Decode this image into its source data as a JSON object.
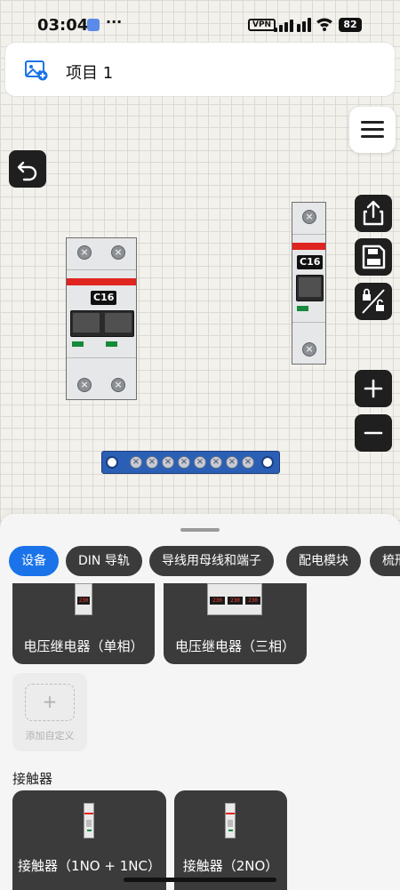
{
  "status_bar": {
    "time": "03:04",
    "dots": "···",
    "vpn": "VPN",
    "battery": "82"
  },
  "project": {
    "title": "项目 1"
  },
  "canvas": {
    "breaker_double": {
      "label": "C16",
      "screw": "×"
    },
    "breaker_single": {
      "label": "C16",
      "screw": "×"
    }
  },
  "toolbar": {
    "icons": [
      "share-icon",
      "save-icon",
      "lock-unlock-icon",
      "zoom-in-icon",
      "zoom-out-icon",
      "undo-icon",
      "menu-icon"
    ]
  },
  "sheet": {
    "tabs": [
      "设备",
      "DIN 导轨",
      "导线用母线和端子",
      "配电模块",
      "梳形"
    ],
    "active_tab": "设备",
    "cards_row1": [
      {
        "label": "电压继电器（单相）",
        "digits": [
          "230"
        ]
      },
      {
        "label": "电压继电器（三相）",
        "digits": [
          "230",
          "230",
          "230"
        ]
      }
    ],
    "add_custom": {
      "plus": "+",
      "label": "添加自定义"
    },
    "section_title": "接触器",
    "cards_row2": [
      {
        "label": "接触器（1NO + 1NC）"
      },
      {
        "label": "接触器（2NO）"
      }
    ]
  },
  "colors": {
    "accent": "#1a73e8",
    "breaker_red": "#e0241f",
    "busbar": "#2b5fb5",
    "indicator_green": "#158a3a"
  }
}
